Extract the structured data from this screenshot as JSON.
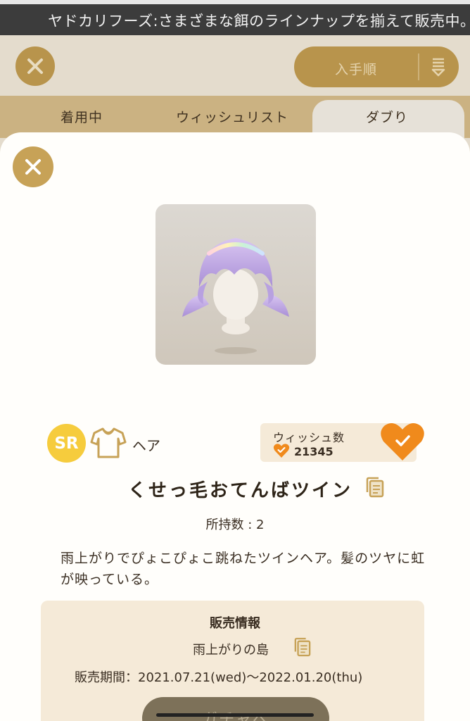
{
  "ticker": {
    "text": "ヤドカリフーズ:さまざまな餌のラインナップを揃えて販売中。"
  },
  "background": {
    "sort_label": "入手順",
    "tabs": [
      "着用中",
      "ウィッシュリスト",
      "ダブり"
    ],
    "active_tab_index": 2
  },
  "item": {
    "rarity": "SR",
    "category_icon": "shirt-icon",
    "category": "ヘア",
    "wish_label": "ウィッシュ数",
    "wish_count": "21345",
    "name": "くせっ毛おてんばツイン",
    "owned": "所持数 : 2",
    "description": "雨上がりでぴょこぴょこ跳ねたツインヘア。髪のツヤに虹が映っている。"
  },
  "sale": {
    "title": "販売情報",
    "place": "雨上がりの島",
    "period": "販売期間：2021.07.21(wed)～2022.01.20(thu)"
  },
  "gacha_button": "ガチャへ",
  "colors": {
    "accent_gold": "#c7a257",
    "heart_orange": "#f08a1c",
    "rarity_yellow": "#f6cc3d",
    "panel_beige": "#f5ead8"
  }
}
